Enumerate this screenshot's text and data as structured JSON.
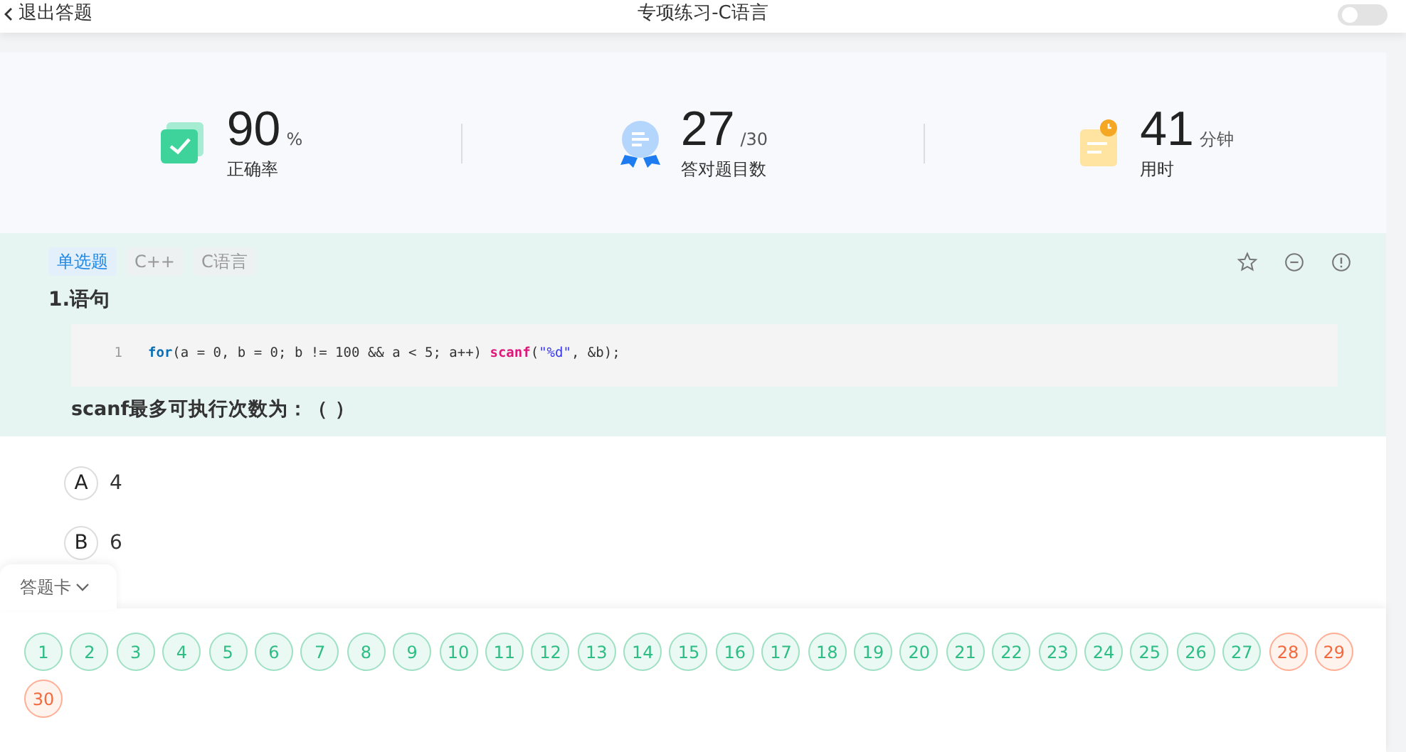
{
  "header": {
    "back_label": "退出答题",
    "title": "专项练习-C语言",
    "toggle": {
      "on": false
    }
  },
  "stats": [
    {
      "kind": "accuracy",
      "value": "90",
      "unit": "%",
      "label": "正确率"
    },
    {
      "kind": "correct",
      "value": "27",
      "unit": "/30",
      "label": "答对题目数"
    },
    {
      "kind": "time",
      "value": "41",
      "unit": "分钟",
      "label": "用时"
    }
  ],
  "question": {
    "tags": [
      {
        "text": "单选题",
        "kind": "type"
      },
      {
        "text": "C++",
        "kind": "topic"
      },
      {
        "text": "C语言",
        "kind": "topic"
      }
    ],
    "number": "1.",
    "stem": "语句",
    "code": {
      "line_number": "1",
      "tokens": [
        {
          "kind": "keyword",
          "text": "for"
        },
        {
          "kind": "plain",
          "text": "(a = 0, b = 0; b != 100 && a < 5; a++) "
        },
        {
          "kind": "function",
          "text": "scanf"
        },
        {
          "kind": "plain",
          "text": "("
        },
        {
          "kind": "string",
          "text": "\"%d\""
        },
        {
          "kind": "plain",
          "text": ", &b);"
        }
      ]
    },
    "prompt": "scanf最多可执行次数为：（ ）"
  },
  "options": [
    {
      "letter": "A",
      "text": "4"
    },
    {
      "letter": "B",
      "text": "6"
    }
  ],
  "answer_card": {
    "label": "答题卡",
    "items": [
      {
        "text": "1",
        "kind": "correct"
      },
      {
        "text": "2",
        "kind": "correct"
      },
      {
        "text": "3",
        "kind": "correct"
      },
      {
        "text": "4",
        "kind": "correct"
      },
      {
        "text": "5",
        "kind": "correct"
      },
      {
        "text": "6",
        "kind": "correct"
      },
      {
        "text": "7",
        "kind": "correct"
      },
      {
        "text": "8",
        "kind": "correct"
      },
      {
        "text": "9",
        "kind": "correct"
      },
      {
        "text": "10",
        "kind": "correct"
      },
      {
        "text": "11",
        "kind": "correct"
      },
      {
        "text": "12",
        "kind": "correct"
      },
      {
        "text": "13",
        "kind": "correct"
      },
      {
        "text": "14",
        "kind": "correct"
      },
      {
        "text": "15",
        "kind": "correct"
      },
      {
        "text": "16",
        "kind": "correct"
      },
      {
        "text": "17",
        "kind": "correct"
      },
      {
        "text": "18",
        "kind": "correct"
      },
      {
        "text": "19",
        "kind": "correct"
      },
      {
        "text": "20",
        "kind": "correct"
      },
      {
        "text": "21",
        "kind": "correct"
      },
      {
        "text": "22",
        "kind": "correct"
      },
      {
        "text": "23",
        "kind": "correct"
      },
      {
        "text": "24",
        "kind": "correct"
      },
      {
        "text": "25",
        "kind": "correct"
      },
      {
        "text": "26",
        "kind": "correct"
      },
      {
        "text": "27",
        "kind": "correct"
      },
      {
        "text": "28",
        "kind": "wrong"
      },
      {
        "text": "29",
        "kind": "wrong"
      },
      {
        "text": "30",
        "kind": "wrong"
      }
    ]
  }
}
